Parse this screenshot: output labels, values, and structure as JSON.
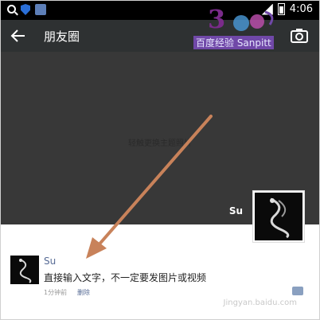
{
  "status_bar": {
    "time": "4:06"
  },
  "header": {
    "title": "朋友圈"
  },
  "watermark_logo": {
    "number": "3",
    "caption": "百度经验 Sanpitt"
  },
  "cover": {
    "hint": "轻触更换主题照片"
  },
  "profile": {
    "name": "Su"
  },
  "post": {
    "author": "Su",
    "text": "直接输入文字，不一定要发图片或视频",
    "time": "1分钟前",
    "delete_label": "删除"
  },
  "footer_watermark": "Jingyan.baidu.com",
  "annotation": {
    "arrow_color": "#c8825a"
  },
  "colors": {
    "action_bar": "#2e3132",
    "cover": "#383838",
    "link": "#576b95"
  }
}
